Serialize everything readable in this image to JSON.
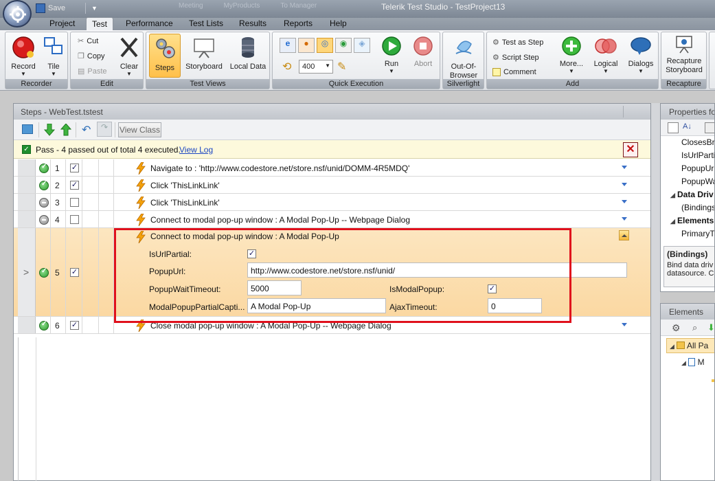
{
  "window": {
    "title": "Telerik Test Studio - TestProject13",
    "qat_save": "Save",
    "faded_tabs": [
      "Meeting",
      "MyProducts",
      "To Manager"
    ]
  },
  "menu": {
    "tabs": [
      "Project",
      "Test",
      "Performance",
      "Test Lists",
      "Results",
      "Reports",
      "Help"
    ],
    "active": "Test"
  },
  "ribbon": {
    "recorder": {
      "label": "Recorder",
      "record": "Record",
      "tile": "Tile"
    },
    "edit": {
      "label": "Edit",
      "cut": "Cut",
      "copy": "Copy",
      "paste": "Paste",
      "clear": "Clear"
    },
    "test_views": {
      "label": "Test Views",
      "steps": "Steps",
      "storyboard": "Storyboard",
      "local_data": "Local Data"
    },
    "quick_execution": {
      "label": "Quick Execution",
      "speed": "400",
      "run": "Run",
      "abort": "Abort"
    },
    "silverlight": {
      "label": "Silverlight",
      "oob": "Out-Of-Browser"
    },
    "add": {
      "label": "Add",
      "test_as_step": "Test as Step",
      "script_step": "Script Step",
      "comment": "Comment",
      "more": "More...",
      "logical": "Logical",
      "dialogs": "Dialogs"
    },
    "recapture": {
      "label": "Recapture",
      "recapture_storyboard": "Recapture Storyboard"
    }
  },
  "steps_panel": {
    "title": "Steps - WebTest.tstest",
    "view_class": "View Class",
    "pass_message": "Pass - 4 passed out of total 4 executed.",
    "view_log": "View Log",
    "steps": [
      {
        "num": "1",
        "status": "pass",
        "checked": true,
        "text": "Navigate to : 'http://www.codestore.net/store.nsf/unid/DOMM-4R5MDQ'"
      },
      {
        "num": "2",
        "status": "pass",
        "checked": true,
        "text": "Click 'ThisLinkLink'"
      },
      {
        "num": "3",
        "status": "skip",
        "checked": false,
        "text": "Click 'ThisLinkLink'"
      },
      {
        "num": "4",
        "status": "skip",
        "checked": false,
        "text": "Connect to modal pop-up window : A Modal Pop-Up -- Webpage Dialog"
      },
      {
        "num": "5",
        "status": "pass",
        "checked": true,
        "text": "Connect to modal pop-up window : A Modal Pop-Up"
      },
      {
        "num": "6",
        "status": "pass",
        "checked": true,
        "text": "Close modal pop-up window : A Modal Pop-Up -- Webpage Dialog"
      }
    ],
    "expanded_props": {
      "is_url_partial_label": "IsUrlPartial:",
      "popup_url_label": "PopupUrl:",
      "popup_url_value": "http://www.codestore.net/store.nsf/unid/",
      "popup_wait_label": "PopupWaitTimeout:",
      "popup_wait_value": "5000",
      "is_modal_label": "IsModalPopup:",
      "partial_caption_label": "ModalPopupPartialCapti...",
      "partial_caption_value": "A Modal Pop-Up",
      "ajax_label": "AjaxTimeout:",
      "ajax_value": "0"
    }
  },
  "properties_panel": {
    "title": "Properties fo",
    "rows": [
      "ClosesBro",
      "IsUrlParti",
      "PopupUr",
      "PopupWa"
    ],
    "cat1": "Data Driv",
    "row_bindings": "(Bindings",
    "cat2": "Elements",
    "row_primary": "PrimaryTa",
    "desc_title": "(Bindings)",
    "desc_line1": "Bind data driv",
    "desc_line2": "datasource. C"
  },
  "elements_panel": {
    "title": "Elements",
    "node1": "All Pa",
    "node2": "M"
  },
  "colors": {
    "accent": "#e0101c",
    "highlight": "#fbd8a2",
    "pass": "#2d9a2d"
  }
}
